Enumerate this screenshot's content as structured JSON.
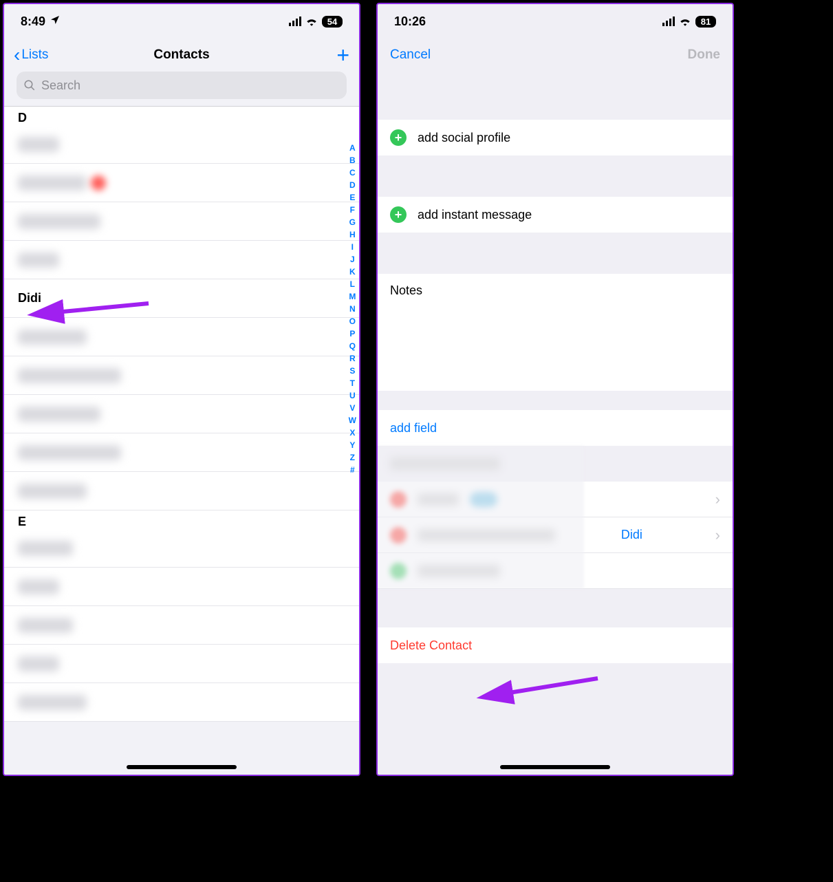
{
  "left": {
    "status": {
      "time": "8:49",
      "battery": "54"
    },
    "nav": {
      "back_label": "Lists",
      "title": "Contacts"
    },
    "search": {
      "placeholder": "Search"
    },
    "sections": {
      "d": "D",
      "e": "E"
    },
    "highlighted_contact": "Didi",
    "index_letters": [
      "A",
      "B",
      "C",
      "D",
      "E",
      "F",
      "G",
      "H",
      "I",
      "J",
      "K",
      "L",
      "M",
      "N",
      "O",
      "P",
      "Q",
      "R",
      "S",
      "T",
      "U",
      "V",
      "W",
      "X",
      "Y",
      "Z",
      "#"
    ]
  },
  "right": {
    "status": {
      "time": "10:26",
      "battery": "81"
    },
    "nav": {
      "cancel": "Cancel",
      "done": "Done"
    },
    "rows": {
      "add_social": "add social profile",
      "add_im": "add instant message",
      "notes": "Notes",
      "add_field": "add field",
      "linked_name": "Didi",
      "delete": "Delete Contact"
    }
  }
}
